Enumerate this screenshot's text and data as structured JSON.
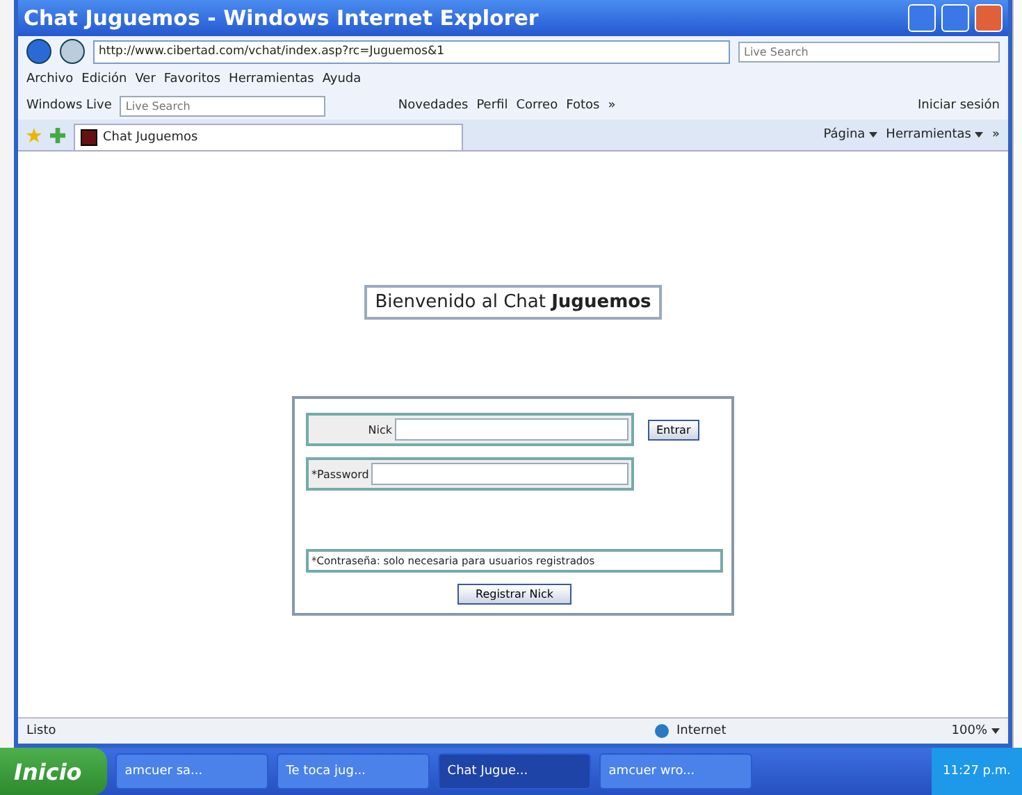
{
  "window": {
    "title": "Chat Juguemos - Windows Internet Explorer"
  },
  "address_bar": {
    "url": "http://www.cibertad.com/vchat/index.asp?rc=Juguemos&1",
    "search_placeholder": "Live Search"
  },
  "menu": [
    "Archivo",
    "Edición",
    "Ver",
    "Favoritos",
    "Herramientas",
    "Ayuda"
  ],
  "live_toolbar": {
    "brand": "Windows Live",
    "search_placeholder": "Live Search",
    "links": [
      "Novedades",
      "Perfil",
      "Correo",
      "Fotos"
    ],
    "more": "»",
    "sign_in": "Iniciar sesión"
  },
  "tab": {
    "label": "Chat Juguemos"
  },
  "command_bar": {
    "items": [
      "Página",
      "Herramientas"
    ],
    "more": "»"
  },
  "page": {
    "welcome": "Bienvenido al Chat **Juguemos**",
    "nick_label": "Nick",
    "enter_button": "Entrar",
    "password_label": "*Password",
    "note": "*Contraseña: solo necesaria para usuarios registrados",
    "register_button": "Registrar Nick"
  },
  "status_bar": {
    "status": "Listo",
    "zone": "Internet",
    "zoom": "100%"
  },
  "taskbar": {
    "start": "Inicio",
    "tasks": [
      {
        "label": "amcuer sa...",
        "selected": false
      },
      {
        "label": "Te toca jug...",
        "selected": false
      },
      {
        "label": "Chat Jugue...",
        "selected": true
      },
      {
        "label": "amcuer wro...",
        "selected": false
      }
    ],
    "clock": "11:27 p.m."
  }
}
